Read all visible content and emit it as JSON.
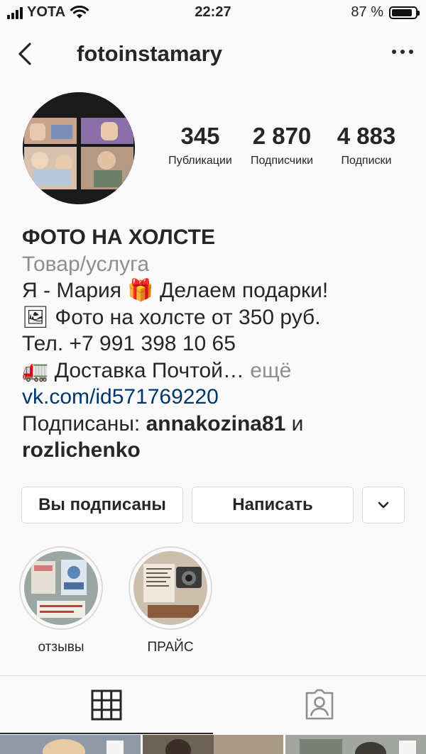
{
  "status_bar": {
    "carrier": "YOTA",
    "time": "22:27",
    "battery": "87 %",
    "battery_level": 0.87
  },
  "header": {
    "username": "fotoinstamary",
    "back_icon": "chevron-left-icon",
    "more_icon": "more-horizontal-icon"
  },
  "stats": [
    {
      "value": "345",
      "label": "Публикации"
    },
    {
      "value": "2 870",
      "label": "Подписчики"
    },
    {
      "value": "4 883",
      "label": "Подписки"
    }
  ],
  "bio": {
    "name": "ФОТО НА ХОЛСТЕ",
    "category": "Товар/услуга",
    "line1_a": "Я - Мария ",
    "line1_emoji": "🎁",
    "line1_b": " Делаем подарки!",
    "line2_emoji": "🖼",
    "line2_text": " Фото на холсте от 350 руб.",
    "line3": "Тел. +7 991 398 10 65",
    "line4_emoji": "🚛",
    "line4_text": " Доставка Почтой…",
    "more": " ещё",
    "link": "vk.com/id571769220",
    "followed_by_prefix": "Подписаны: ",
    "followed_by_1": "annakozina81",
    "followed_by_and": " и",
    "followed_by_2": "rozlichenko"
  },
  "buttons": {
    "following": "Вы подписаны",
    "message": "Написать",
    "dropdown_icon": "chevron-down-icon"
  },
  "highlights": [
    {
      "label": "отзывы"
    },
    {
      "label": "ПРАЙС"
    }
  ],
  "tabs": {
    "grid_icon": "grid-icon",
    "tagged_icon": "tagged-person-icon"
  },
  "colors": {
    "link": "#00376b",
    "secondary_text": "#8e8e8e",
    "border": "#dbdbdb"
  }
}
